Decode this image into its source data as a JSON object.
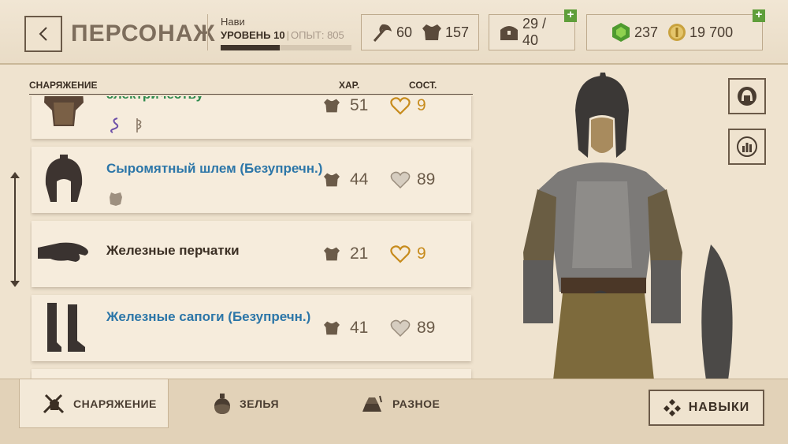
{
  "header": {
    "title": "ПЕРСОНАЖ",
    "character_name": "Нави",
    "level_label": "УРОВЕНЬ 10",
    "xp_label": "ОПЫТ: 805",
    "xp_progress": 0.45,
    "attack": "60",
    "defense": "157",
    "inventory": "29 / 40",
    "gems": "237",
    "gold": "19 700"
  },
  "list": {
    "col_equipment": "СНАРЯЖЕНИЕ",
    "col_stat": "ХАР.",
    "col_condition": "СОСТ.",
    "items": [
      {
        "name": "электричеству",
        "armor": "51",
        "condition": "9",
        "name_color": "#2d8a4d",
        "cond_color": "#c78b1c",
        "icons": [
          "serpent-enchant-icon",
          "rune-enchant-icon"
        ]
      },
      {
        "name": "Сыромятный шлем  (Безупречн.)",
        "armor": "44",
        "condition": "89",
        "name_color": "#2c76a8",
        "cond_color": "#6b5b49",
        "icons": [
          "leather-material-icon"
        ]
      },
      {
        "name": "Железные перчатки",
        "armor": "21",
        "condition": "9",
        "name_color": "#3b2f24",
        "cond_color": "#c78b1c",
        "icons": []
      },
      {
        "name": "Железные сапоги  (Безупречн.)",
        "armor": "41",
        "condition": "89",
        "name_color": "#2c76a8",
        "cond_color": "#6b5b49",
        "icons": []
      }
    ]
  },
  "tabs": {
    "equipment": "СНАРЯЖЕНИЕ",
    "potions": "ЗЕЛЬЯ",
    "misc": "РАЗНОЕ"
  },
  "skills_button": "НАВЫКИ"
}
